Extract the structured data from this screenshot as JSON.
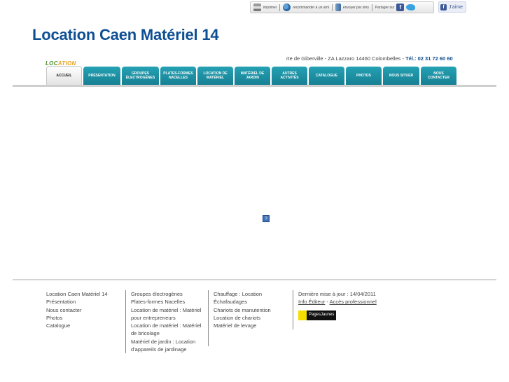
{
  "share_bar": {
    "print": "imprimer",
    "recommend": "recommander à un ami",
    "send": "envoyer par sms",
    "share_on": "Partager sur",
    "like": "J'aime"
  },
  "header": {
    "title": "Location Caen Matériel 14",
    "logo_text_a": "LOC",
    "logo_text_b": "ATION",
    "address": "rte de Giberville - ZA Lazzaro 14460 Colombelles  -  ",
    "phone_label": "Tél.: ",
    "phone": "02 31 72 60 60"
  },
  "nav": [
    {
      "label": "Accueil",
      "active": true
    },
    {
      "label": "Présentation"
    },
    {
      "label": "Groupes électrogènes"
    },
    {
      "label": "Plates-formes Nacelles"
    },
    {
      "label": "Location de matériel"
    },
    {
      "label": "Matériel de jardin"
    },
    {
      "label": "Autres activités"
    },
    {
      "label": "Catalogue"
    },
    {
      "label": "Photos"
    },
    {
      "label": "Nous situer"
    },
    {
      "label": "Nous contacter"
    }
  ],
  "placeholder_icon": "?",
  "footer": {
    "col1": [
      "Location Caen Matériel 14",
      "Présentation",
      "Nous contacter",
      "Photos",
      "Catalogue"
    ],
    "col2": [
      "Groupes électrogènes",
      "Plates-formes Nacelles",
      "Location de matériel : Matériel",
      "pour entrepreneurs",
      "Location de matériel : Matériel",
      "de bricolage",
      "Matériel de jardin : Location",
      "d'appareils de jardinage"
    ],
    "col3": [
      "Chauffage : Location",
      "Échafaudages",
      "Chariots de manutention",
      "Location de chariots",
      "Matériel de levage"
    ],
    "updated": "Dernière mise à jour : 14/04/2011",
    "info_editeur": "Info Éditeur",
    "dash": " - ",
    "acces_pro": "Accès professionnel",
    "pages_jaunes": "PagesJaunes"
  }
}
